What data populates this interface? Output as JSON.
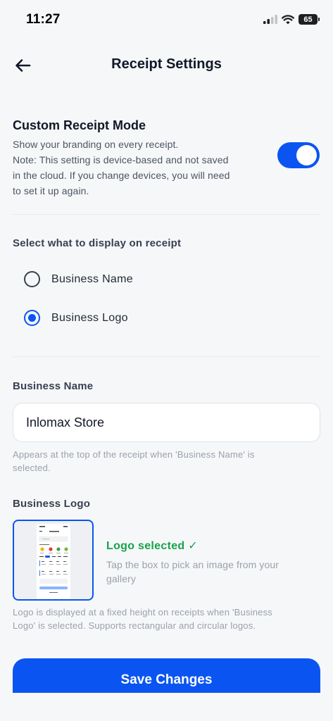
{
  "status_bar": {
    "time": "11:27",
    "battery": "65"
  },
  "header": {
    "title": "Receipt Settings"
  },
  "custom_mode": {
    "title": "Custom Receipt Mode",
    "lines": [
      "Show your branding on every receipt.",
      "Note: This setting is device-based and not saved",
      "in the cloud. If you change devices, you will need",
      "to set it up again."
    ],
    "enabled": true
  },
  "display_options": {
    "title": "Select what to display on receipt",
    "options": [
      {
        "label": "Business Name",
        "selected": false
      },
      {
        "label": "Business Logo",
        "selected": true
      }
    ]
  },
  "business_name": {
    "label": "Business Name",
    "value": "Inlomax Store",
    "helper_lines": [
      "Appears at the top of the receipt when 'Business Name' is",
      "selected."
    ]
  },
  "business_logo": {
    "label": "Business Logo",
    "status": "Logo selected ✓",
    "hint_lines": [
      "Tap the box to pick an image from your",
      "gallery"
    ],
    "helper_lines": [
      "Logo is displayed at a fixed height on receipts when 'Business",
      "Logo' is selected. Supports rectangular and circular logos."
    ]
  },
  "actions": {
    "save_label": "Save Changes"
  },
  "colors": {
    "accent": "#0a55f2",
    "success": "#16a34a"
  }
}
